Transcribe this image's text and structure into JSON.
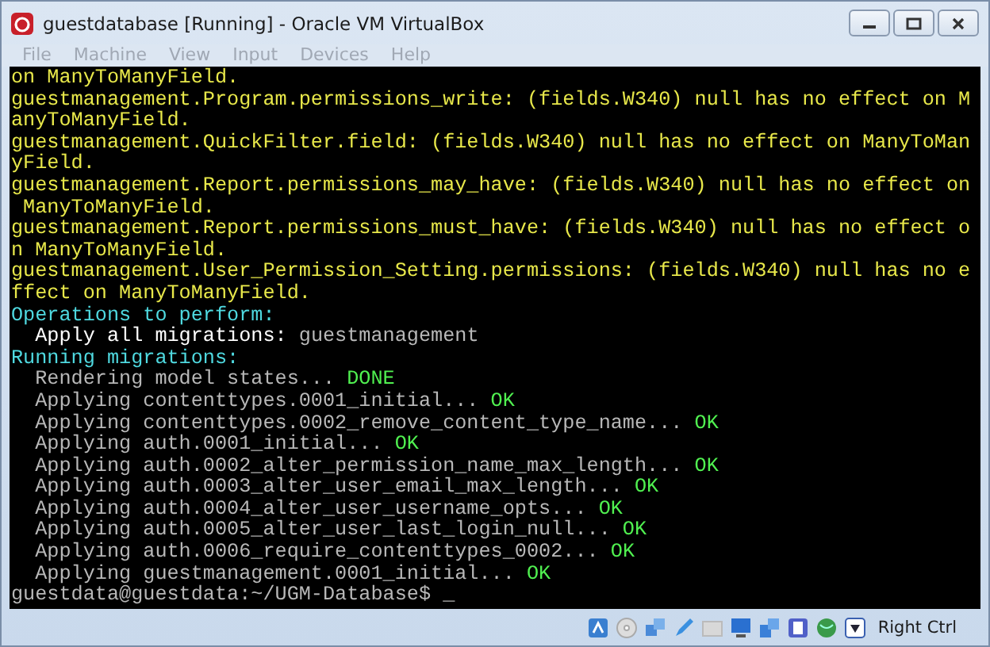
{
  "window": {
    "title": "guestdatabase [Running] - Oracle VM VirtualBox"
  },
  "menu": [
    {
      "label": "File",
      "disabled": true
    },
    {
      "label": "Machine",
      "disabled": true
    },
    {
      "label": "View",
      "disabled": true
    },
    {
      "label": "Input",
      "disabled": true
    },
    {
      "label": "Devices",
      "disabled": true
    },
    {
      "label": "Help",
      "disabled": true
    }
  ],
  "console": {
    "lines": [
      [
        {
          "kind": "warning",
          "text": "on ManyToManyField."
        }
      ],
      [
        {
          "kind": "warning",
          "text": "guestmanagement.Program.permissions_write: (fields.W340) null has no effect on M"
        }
      ],
      [
        {
          "kind": "warning",
          "text": "anyToManyField."
        }
      ],
      [
        {
          "kind": "warning",
          "text": "guestmanagement.QuickFilter.field: (fields.W340) null has no effect on ManyToMan"
        }
      ],
      [
        {
          "kind": "warning",
          "text": "yField."
        }
      ],
      [
        {
          "kind": "warning",
          "text": "guestmanagement.Report.permissions_may_have: (fields.W340) null has no effect on"
        }
      ],
      [
        {
          "kind": "warning",
          "text": " ManyToManyField."
        }
      ],
      [
        {
          "kind": "warning",
          "text": "guestmanagement.Report.permissions_must_have: (fields.W340) null has no effect o"
        }
      ],
      [
        {
          "kind": "warning",
          "text": "n ManyToManyField."
        }
      ],
      [
        {
          "kind": "warning",
          "text": "guestmanagement.User_Permission_Setting.permissions: (fields.W340) null has no e"
        }
      ],
      [
        {
          "kind": "warning",
          "text": "ffect on ManyToManyField."
        }
      ],
      [
        {
          "kind": "heading",
          "text": "Operations to perform:"
        }
      ],
      [
        {
          "kind": "label",
          "text": "  Apply all migrations:"
        },
        {
          "kind": "plain",
          "text": " guestmanagement"
        }
      ],
      [
        {
          "kind": "heading",
          "text": "Running migrations:"
        }
      ],
      [
        {
          "kind": "plain",
          "text": "  Rendering model states..."
        },
        {
          "kind": "success",
          "text": " DONE"
        }
      ],
      [
        {
          "kind": "plain",
          "text": "  Applying contenttypes.0001_initial..."
        },
        {
          "kind": "success",
          "text": " OK"
        }
      ],
      [
        {
          "kind": "plain",
          "text": "  Applying contenttypes.0002_remove_content_type_name..."
        },
        {
          "kind": "success",
          "text": " OK"
        }
      ],
      [
        {
          "kind": "plain",
          "text": "  Applying auth.0001_initial..."
        },
        {
          "kind": "success",
          "text": " OK"
        }
      ],
      [
        {
          "kind": "plain",
          "text": "  Applying auth.0002_alter_permission_name_max_length..."
        },
        {
          "kind": "success",
          "text": " OK"
        }
      ],
      [
        {
          "kind": "plain",
          "text": "  Applying auth.0003_alter_user_email_max_length..."
        },
        {
          "kind": "success",
          "text": " OK"
        }
      ],
      [
        {
          "kind": "plain",
          "text": "  Applying auth.0004_alter_user_username_opts..."
        },
        {
          "kind": "success",
          "text": " OK"
        }
      ],
      [
        {
          "kind": "plain",
          "text": "  Applying auth.0005_alter_user_last_login_null..."
        },
        {
          "kind": "success",
          "text": " OK"
        }
      ],
      [
        {
          "kind": "plain",
          "text": "  Applying auth.0006_require_contenttypes_0002..."
        },
        {
          "kind": "success",
          "text": " OK"
        }
      ],
      [
        {
          "kind": "plain",
          "text": "  Applying guestmanagement.0001_initial..."
        },
        {
          "kind": "success",
          "text": " OK"
        }
      ],
      [
        {
          "kind": "plain",
          "text": "guestdata@guestdata:~/UGM-Database$ _"
        }
      ]
    ]
  },
  "status_bar": {
    "host_key": "Right Ctrl"
  }
}
